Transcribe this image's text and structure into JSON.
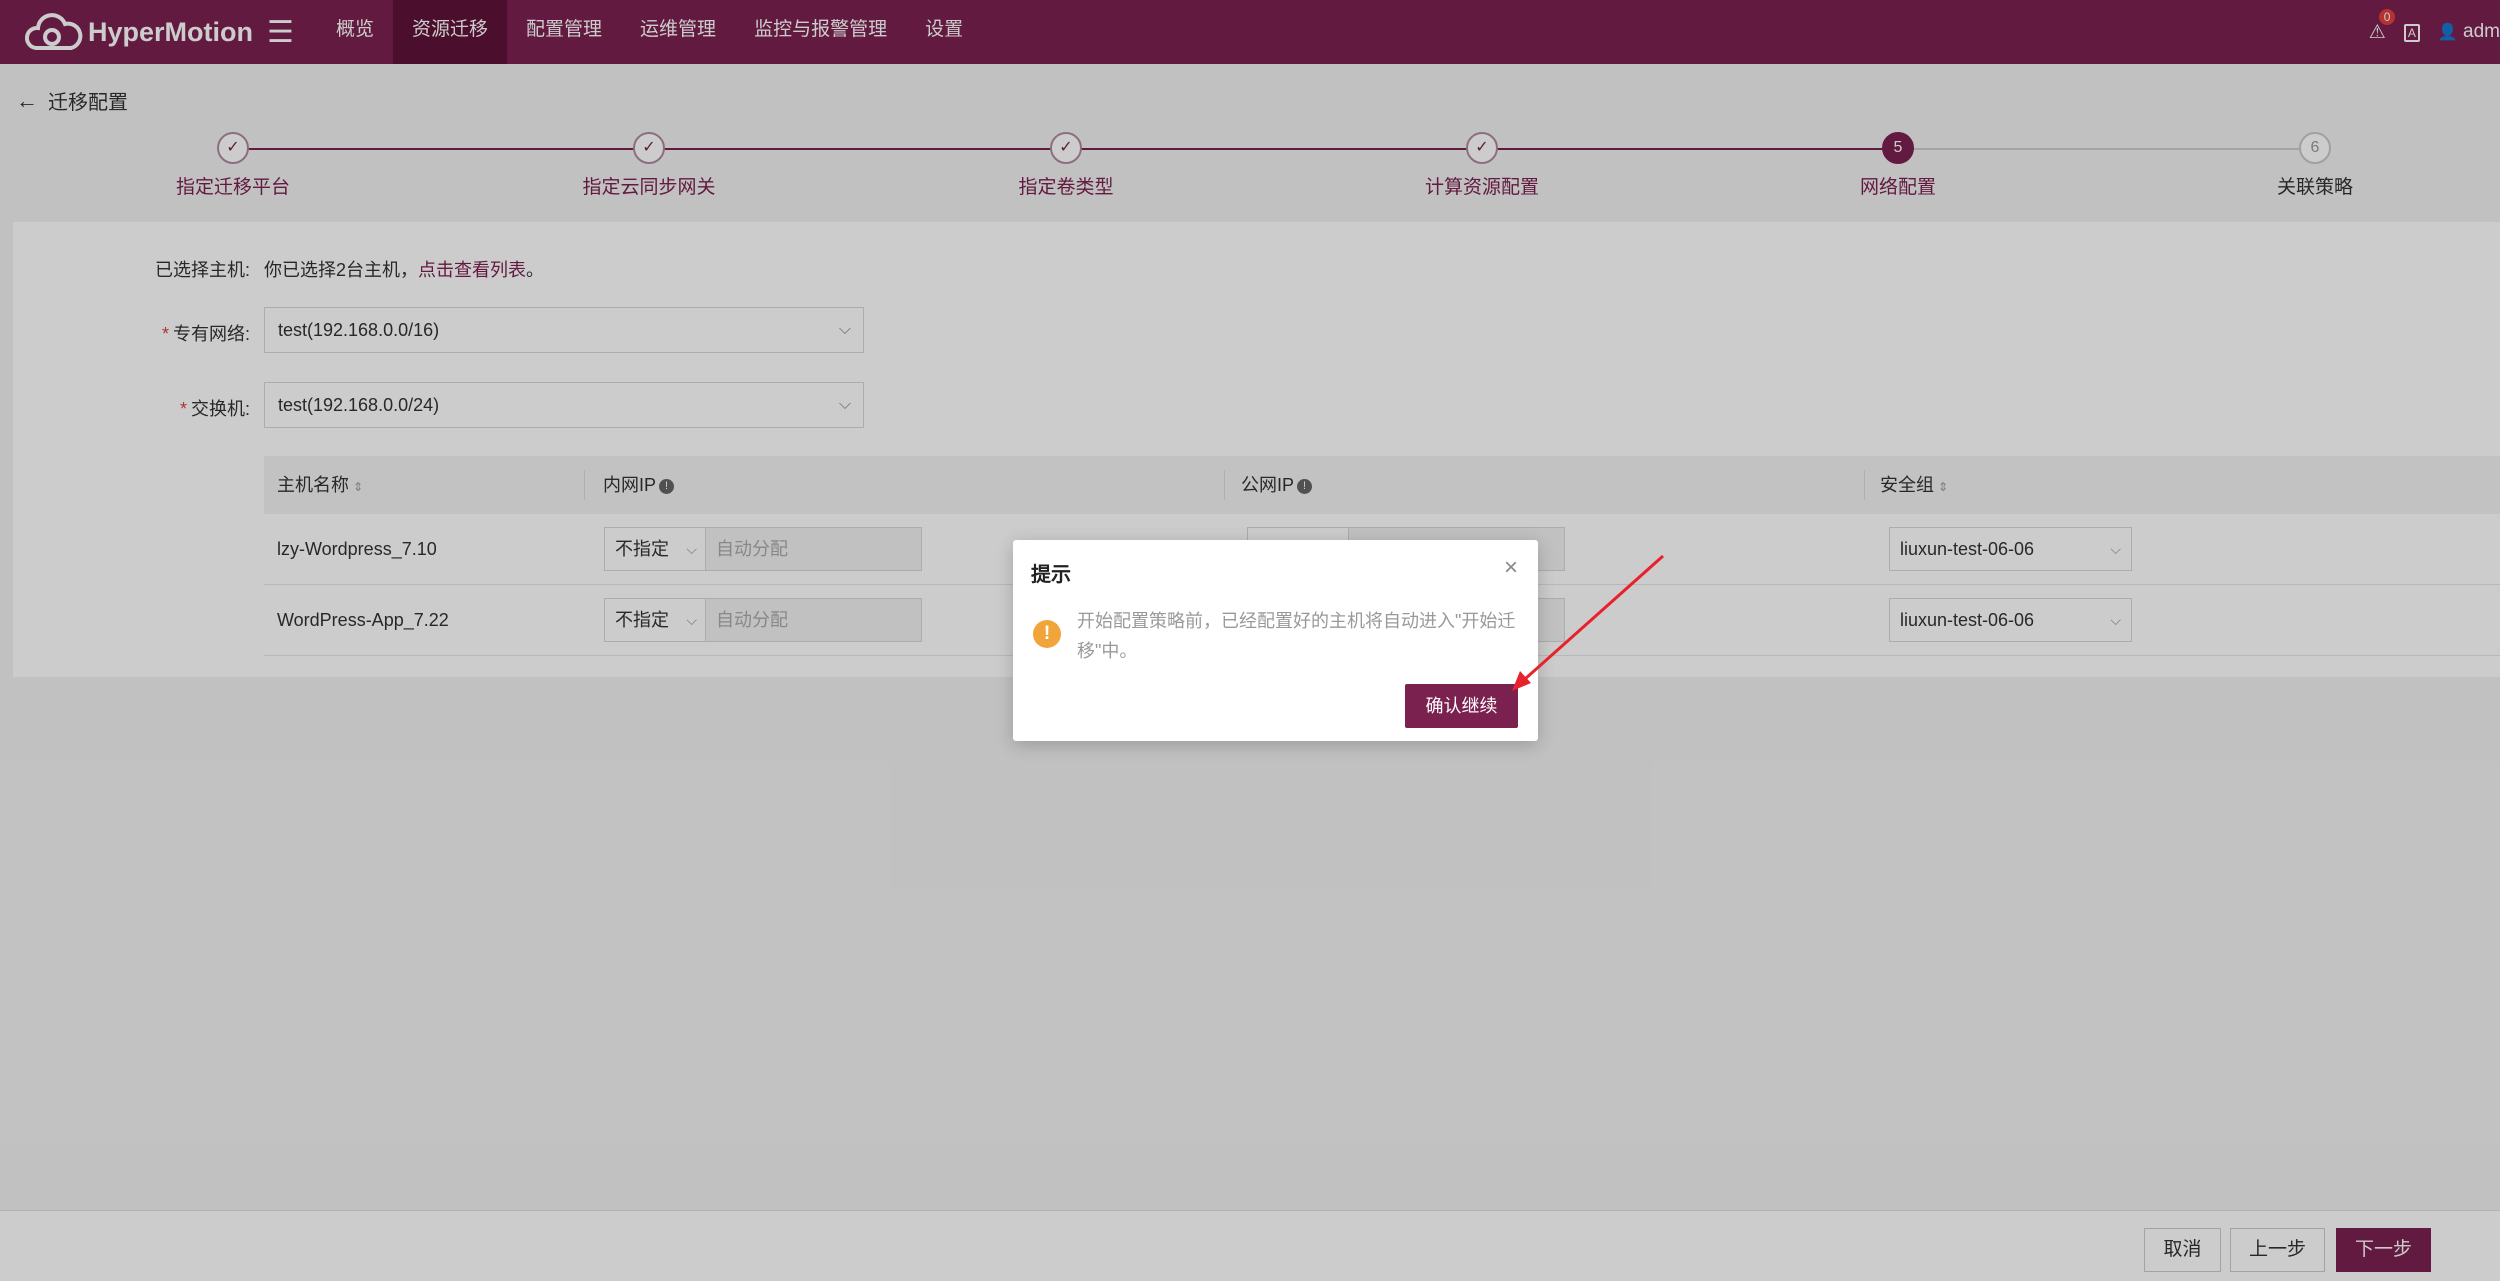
{
  "header": {
    "logo_text": "HyperMotion",
    "menu_icon": "☰",
    "nav": [
      "概览",
      "资源迁移",
      "配置管理",
      "运维管理",
      "监控与报警管理",
      "设置"
    ],
    "active_nav": "资源迁移",
    "alert_count": "0",
    "user": "adm"
  },
  "breadcrumb": {
    "back_label": "迁移配置"
  },
  "steps": [
    {
      "label": "指定迁移平台",
      "status": "done",
      "mark": "✓"
    },
    {
      "label": "指定云同步网关",
      "status": "done",
      "mark": "✓"
    },
    {
      "label": "指定卷类型",
      "status": "done",
      "mark": "✓"
    },
    {
      "label": "计算资源配置",
      "status": "done",
      "mark": "✓"
    },
    {
      "label": "网络配置",
      "status": "current",
      "mark": "5"
    },
    {
      "label": "关联策略",
      "status": "pending",
      "mark": "6"
    }
  ],
  "form": {
    "selected_hosts_label": "已选择主机:",
    "selected_hosts_text": "你已选择2台主机，",
    "view_list_link": "点击查看列表",
    "period": "。",
    "vpc_label": "专有网络:",
    "vpc_value": "test(192.168.0.0/16)",
    "switch_label": "交换机:",
    "switch_value": "test(192.168.0.0/24)"
  },
  "table": {
    "columns": [
      "主机名称",
      "内网IP",
      "公网IP",
      "安全组"
    ],
    "rows": [
      {
        "host": "lzy-Wordpress_7.10",
        "ip_mode": "不指定",
        "ip_placeholder": "自动分配",
        "security_group": "liuxun-test-06-06"
      },
      {
        "host": "WordPress-App_7.22",
        "ip_mode": "不指定",
        "ip_placeholder": "自动分配",
        "security_group": "liuxun-test-06-06"
      }
    ]
  },
  "footer": {
    "cancel": "取消",
    "prev": "上一步",
    "next": "下一步"
  },
  "dialog": {
    "title": "提示",
    "message": "开始配置策略前，已经配置好的主机将自动进入\"开始迁移\"中。",
    "confirm": "确认继续"
  },
  "colors": {
    "brand": "#7b2150",
    "brand_dark": "#5e1239",
    "warning": "#f0a43a",
    "annotation": "#e8222c"
  }
}
